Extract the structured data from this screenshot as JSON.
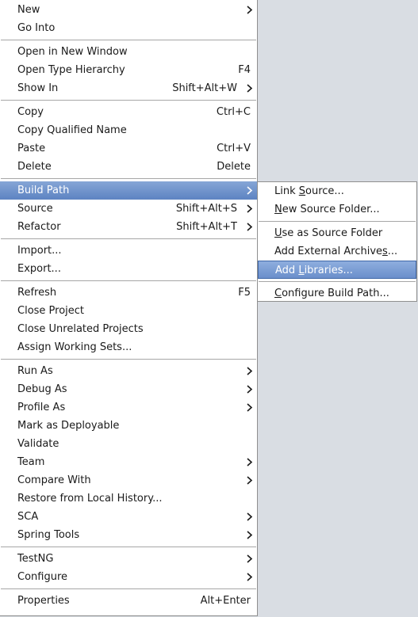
{
  "main_menu": {
    "groups": [
      [
        {
          "label": "New",
          "shortcut": "",
          "submenu": true
        },
        {
          "label": "Go Into",
          "shortcut": "",
          "submenu": false
        }
      ],
      [
        {
          "label": "Open in New Window",
          "shortcut": "",
          "submenu": false
        },
        {
          "label": "Open Type Hierarchy",
          "shortcut": "F4",
          "submenu": false
        },
        {
          "label": "Show In",
          "shortcut": "Shift+Alt+W",
          "submenu": true
        }
      ],
      [
        {
          "label": "Copy",
          "shortcut": "Ctrl+C",
          "submenu": false
        },
        {
          "label": "Copy Qualified Name",
          "shortcut": "",
          "submenu": false
        },
        {
          "label": "Paste",
          "shortcut": "Ctrl+V",
          "submenu": false
        },
        {
          "label": "Delete",
          "shortcut": "Delete",
          "submenu": false
        }
      ],
      [
        {
          "label": "Build Path",
          "shortcut": "",
          "submenu": true,
          "highlighted": true
        },
        {
          "label": "Source",
          "shortcut": "Shift+Alt+S",
          "submenu": true
        },
        {
          "label": "Refactor",
          "shortcut": "Shift+Alt+T",
          "submenu": true
        }
      ],
      [
        {
          "label": "Import...",
          "shortcut": "",
          "submenu": false
        },
        {
          "label": "Export...",
          "shortcut": "",
          "submenu": false
        }
      ],
      [
        {
          "label": "Refresh",
          "shortcut": "F5",
          "submenu": false
        },
        {
          "label": "Close Project",
          "shortcut": "",
          "submenu": false
        },
        {
          "label": "Close Unrelated Projects",
          "shortcut": "",
          "submenu": false
        },
        {
          "label": "Assign Working Sets...",
          "shortcut": "",
          "submenu": false
        }
      ],
      [
        {
          "label": "Run As",
          "shortcut": "",
          "submenu": true
        },
        {
          "label": "Debug As",
          "shortcut": "",
          "submenu": true
        },
        {
          "label": "Profile As",
          "shortcut": "",
          "submenu": true
        },
        {
          "label": "Mark as Deployable",
          "shortcut": "",
          "submenu": false
        },
        {
          "label": "Validate",
          "shortcut": "",
          "submenu": false
        },
        {
          "label": "Team",
          "shortcut": "",
          "submenu": true
        },
        {
          "label": "Compare With",
          "shortcut": "",
          "submenu": true
        },
        {
          "label": "Restore from Local History...",
          "shortcut": "",
          "submenu": false
        },
        {
          "label": "SCA",
          "shortcut": "",
          "submenu": true
        },
        {
          "label": "Spring Tools",
          "shortcut": "",
          "submenu": true
        }
      ],
      [
        {
          "label": "TestNG",
          "shortcut": "",
          "submenu": true
        },
        {
          "label": "Configure",
          "shortcut": "",
          "submenu": true
        }
      ],
      [
        {
          "label": "Properties",
          "shortcut": "Alt+Enter",
          "submenu": false
        }
      ]
    ]
  },
  "build_path_submenu": {
    "groups": [
      [
        {
          "label": "Link Source...",
          "mnemonic_index": 5
        },
        {
          "label": "New Source Folder...",
          "mnemonic_index": 0
        }
      ],
      [
        {
          "label": "Use as Source Folder",
          "mnemonic_index": 0
        },
        {
          "label": "Add External Archives...",
          "mnemonic_index": 20
        },
        {
          "label": "Add Libraries...",
          "mnemonic_index": 4,
          "highlighted": true
        }
      ],
      [
        {
          "label": "Configure Build Path...",
          "mnemonic_index": 0
        }
      ]
    ]
  },
  "colors": {
    "highlight_top": "#86a6d6",
    "highlight_bottom": "#5d83c2",
    "menu_bg": "#ffffff",
    "separator": "#a6a6a6"
  }
}
